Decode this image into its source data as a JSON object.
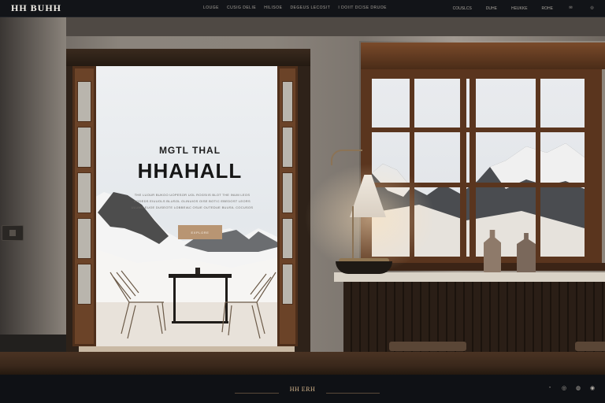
{
  "header": {
    "logo": "HH BUHH",
    "nav": [
      "LOUGE",
      "CUSIG DELIE",
      "HILISOE",
      "DEGEUS LECOSIT",
      "I DOIIT DCISE DRUOE"
    ],
    "right_nav": [
      "COUSLCS",
      "DUHE",
      "HEUKKE",
      "ROHE"
    ],
    "icons": [
      "mail-icon",
      "user-icon"
    ]
  },
  "hero": {
    "kicker": "MGTL THAL",
    "title": "HHAHALL",
    "copy_lines": [
      "THE LUOUR BUKOO UOPESOR UOL ROGSIIS BLOT THE INUM LEOS",
      "BODEDS EIUUOLS BLUSOL OLINUIOS OISE BOTIC EBEDOST LEORS",
      "ULUMO EUOE DUSEOTE LOBBEIAC OSUE OUTEDUE BUUSIL COCUSOS"
    ],
    "button": "EXPLORE"
  },
  "footer": {
    "brand": "HH ERH",
    "icons": [
      "share-icon",
      "chat-icon",
      "globe-icon",
      "settings-icon"
    ]
  }
}
